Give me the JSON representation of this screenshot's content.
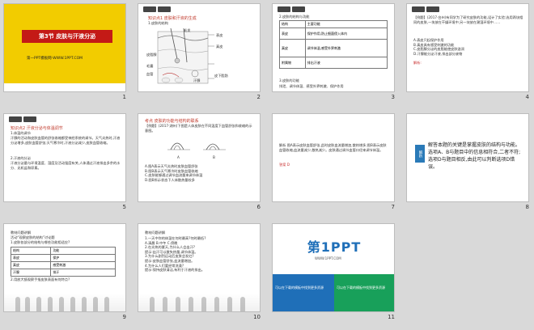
{
  "slides": [
    {
      "num": "1",
      "title": "第3节  皮肤与汗液分泌",
      "footer": "第一PPT模板网-WWW.1PPT.COM",
      "bg": "#f2cc00",
      "title_bg": "#c41a16"
    },
    {
      "num": "2",
      "heading": "知识点1  皮肤和汗液的生成",
      "sub": "1.皮肤的结构",
      "labels": [
        "毛发",
        "表皮",
        "皮脂腺",
        "真皮",
        "汗腺",
        "毛囊",
        "血管",
        "皮下脂肪"
      ]
    },
    {
      "num": "3",
      "heading": "2.皮肤的结构与功能",
      "t_head": [
        "结构",
        "主要功能"
      ],
      "rows": [
        [
          "表皮",
          "保护作用,防止细菌侵入体内"
        ],
        [
          "真皮",
          "调节体温,感受外界刺激"
        ],
        [
          "附属物",
          "排出汗液"
        ]
      ],
      "sub": "3.皮肤的功能",
      "foot": "排泄、调节体温、感受外界刺激、保护作用"
    },
    {
      "num": "4",
      "para": "【例题】(2017·台州)有同学为了研究皮肤的功能,设计了实验:选用两块相同的皮肤,一块放在干燥环境中,另一块放在潮湿环境中……",
      "opts": [
        "A.表皮只起保护作用",
        "B.真皮具有感受刺激的功能",
        "C.皮脂腺分泌的皮脂能使皮肤滋润",
        "D.汗腺能分泌汗液,排出部分废物"
      ],
      "ans": "解析:"
    },
    {
      "num": "5",
      "heading": "知识点2  汗液分泌与体温调节",
      "sub": "1.体温的调节",
      "para": "汗腺的活动和皮肤血管的舒张收缩都受神经系统的调节。天气炎热时,汗液分泌增多,皮肤血管舒张;天气寒冷时,汗液分泌减少,皮肤血管收缩。",
      "sub2": "2.汗液的分泌",
      "para2": "汗液分泌量与环境温度、湿度及活动强度有关,人体通过汗液排出多余的水分、无机盐和尿素。"
    },
    {
      "num": "6",
      "heading": "考点  皮肤的功能与结构的联系",
      "para": "【例题】(2017·湖州)下图是人体皮肤在不同温度下血管舒张和收缩的示意图。",
      "fig": [
        "A",
        "B"
      ],
      "opts": [
        "A.图A表示天气炎热时皮肤血管舒张",
        "B.图B表示天气寒冷时皮肤血管收缩",
        "C.皮肤能够通过调节血流量来调节体温",
        "D.图B所示状态下人体散热量较多"
      ]
    },
    {
      "num": "7",
      "para": "解析  图A表示皮肤血管舒张,此时皮肤血流量增加,散热增多;图B表示皮肤血管收缩,血流量减少,散热减少。皮肤通过调节血管口径来调节体温。",
      "ans": "答案  D"
    },
    {
      "num": "8",
      "label": "解析",
      "para": "解答本题的关键是掌握皮肤的结构与功能。选项A、B与题目中的信息相符合,二者不符;选项D与题目相反,由此可以判断选项D错误。"
    },
    {
      "num": "9",
      "heading": "教材问题讲解",
      "sub": "活动“观察皮肤的结构”讨论题",
      "para": "1.皮肤各部分的结构与哪些功能相适应?",
      "t_head": [
        "结构",
        "功能"
      ],
      "rows": [
        [
          "表皮",
          "保护"
        ],
        [
          "真皮",
          "感受刺激"
        ],
        [
          "汗腺",
          "排汗"
        ]
      ],
      "foot": "2.用放大镜观察手指皮肤表面有何特点?"
    },
    {
      "num": "10",
      "heading": "教材问题讲解",
      "items": [
        "1.一天中你的体温在何时最高?何时最低?",
        "A.清晨  B.中午  C.傍晚",
        "2.在炎热的夏天,为什么人会出汗?",
        "提示:出汗可以散失热量,调节体温。",
        "3.为什么剧烈运动后皮肤会发红?",
        "提示:皮肤血管舒张,血流量增加。",
        "4.为什么人们要经常洗澡?",
        "提示:保持皮肤清洁,有利于汗液的排出。"
      ]
    },
    {
      "num": "11",
      "brand": "第1PPT",
      "sub": "WWW.1PPT.COM",
      "left_box": "可以在下载的模板中找到更多资源",
      "right_box": "可以在下载的模板中找到更多资源"
    }
  ]
}
